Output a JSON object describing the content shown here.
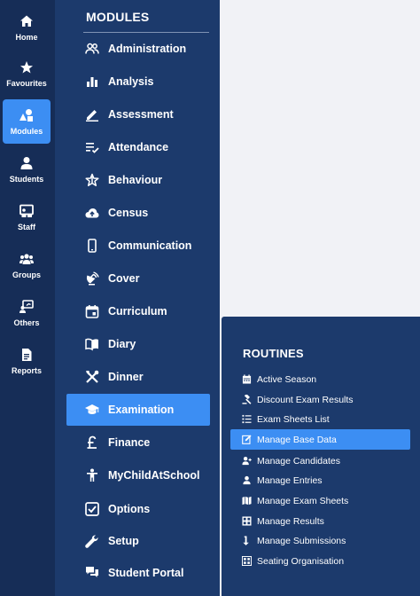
{
  "rail": {
    "items": [
      {
        "label": "Home",
        "icon": "home-icon"
      },
      {
        "label": "Favourites",
        "icon": "star-icon"
      },
      {
        "label": "Modules",
        "icon": "shapes-icon",
        "active": true
      },
      {
        "label": "Students",
        "icon": "user-icon"
      },
      {
        "label": "Staff",
        "icon": "teacher-board-icon"
      },
      {
        "label": "Groups",
        "icon": "users-icon"
      },
      {
        "label": "Others",
        "icon": "presenter-icon"
      },
      {
        "label": "Reports",
        "icon": "report-file-icon"
      }
    ]
  },
  "modules": {
    "title": "MODULES",
    "items": [
      {
        "label": "Administration",
        "icon": "user-group-icon"
      },
      {
        "label": "Analysis",
        "icon": "bar-chart-icon"
      },
      {
        "label": "Assessment",
        "icon": "pencil-icon"
      },
      {
        "label": "Attendance",
        "icon": "checklist-icon"
      },
      {
        "label": "Behaviour",
        "icon": "star-outline-icon"
      },
      {
        "label": "Census",
        "icon": "cloud-upload-icon"
      },
      {
        "label": "Communication",
        "icon": "mobile-phone-icon"
      },
      {
        "label": "Cover",
        "icon": "satellite-dish-icon"
      },
      {
        "label": "Curriculum",
        "icon": "calendar-icon"
      },
      {
        "label": "Diary",
        "icon": "book-open-icon"
      },
      {
        "label": "Dinner",
        "icon": "cutlery-icon"
      },
      {
        "label": "Examination",
        "icon": "graduation-cap-icon",
        "active": true
      },
      {
        "label": "Finance",
        "icon": "pound-icon"
      },
      {
        "label": "MyChildAtSchool",
        "icon": "child-icon"
      },
      {
        "label": "Options",
        "icon": "checkbox-icon"
      },
      {
        "label": "Setup",
        "icon": "wrench-icon"
      },
      {
        "label": "Student Portal",
        "icon": "chat-icon"
      }
    ]
  },
  "routines": {
    "title": "ROUTINES",
    "items": [
      {
        "label": "Active Season",
        "icon": "calendar-icon"
      },
      {
        "label": "Discount Exam Results",
        "icon": "gavel-icon"
      },
      {
        "label": "Exam Sheets List",
        "icon": "list-icon"
      },
      {
        "label": "Manage Base Data",
        "icon": "edit-icon",
        "active": true
      },
      {
        "label": "Manage Candidates",
        "icon": "user-plus-icon"
      },
      {
        "label": "Manage Entries",
        "icon": "user-icon"
      },
      {
        "label": "Manage Exam Sheets",
        "icon": "map-icon"
      },
      {
        "label": "Manage Results",
        "icon": "grid-icon"
      },
      {
        "label": "Manage Submissions",
        "icon": "arrow-down-icon"
      },
      {
        "label": "Seating Organisation",
        "icon": "seating-grid-icon"
      }
    ]
  },
  "colors": {
    "rail_bg": "#162d57",
    "panel_bg": "#1c3a6c",
    "accent": "#3c8ef3",
    "content_bg": "#f1f2f6"
  }
}
